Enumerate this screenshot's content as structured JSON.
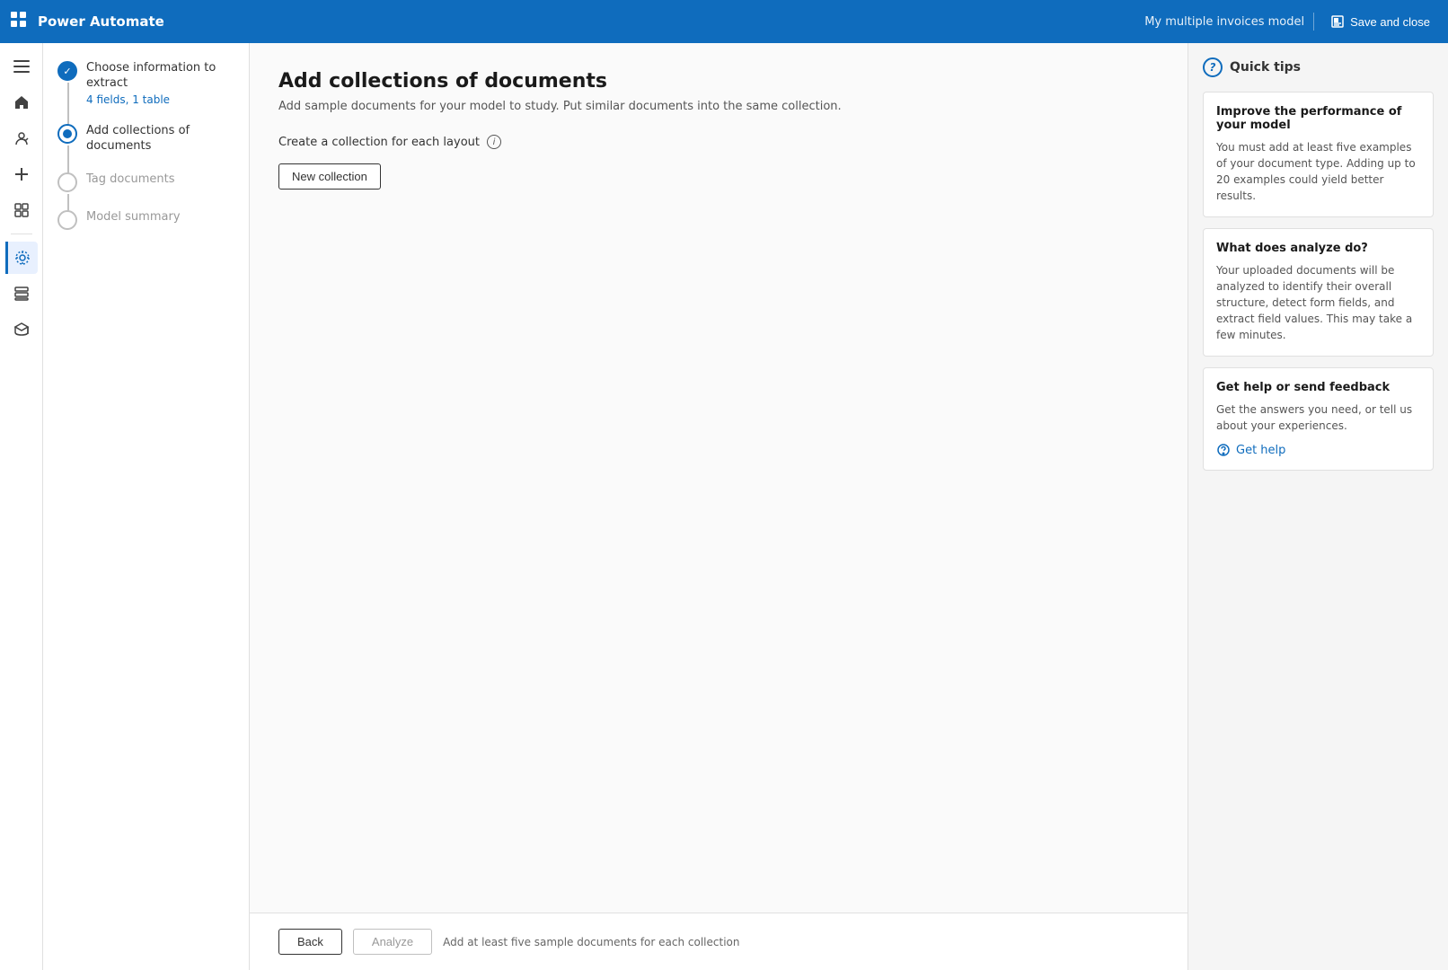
{
  "topbar": {
    "app_title": "Power Automate",
    "model_name": "My multiple invoices model",
    "save_close_label": "Save and close",
    "apps_icon": "⊞"
  },
  "wizard": {
    "steps": [
      {
        "id": "choose-info",
        "title": "Choose information to extract",
        "subtitle": "4 fields, 1 table",
        "state": "completed"
      },
      {
        "id": "add-collections",
        "title": "Add collections of documents",
        "subtitle": "",
        "state": "active"
      },
      {
        "id": "tag-documents",
        "title": "Tag documents",
        "subtitle": "",
        "state": "disabled"
      },
      {
        "id": "model-summary",
        "title": "Model summary",
        "subtitle": "",
        "state": "disabled"
      }
    ]
  },
  "content": {
    "page_title": "Add collections of documents",
    "page_subtitle": "Add sample documents for your model to study. Put similar documents into the same collection.",
    "collection_label": "Create a collection for each layout",
    "new_collection_button": "New collection"
  },
  "quick_tips": {
    "header": "Quick tips",
    "icon_label": "?",
    "tip1_title": "Improve the performance of your model",
    "tip1_text": "You must add at least five examples of your document type. Adding up to 20 examples could yield better results.",
    "tip2_title": "What does analyze do?",
    "tip2_text": "Your uploaded documents will be analyzed to identify their overall structure, detect form fields, and extract field values. This may take a few minutes.",
    "tip3_title": "Get help or send feedback",
    "tip3_text": "Get the answers you need, or tell us about your experiences.",
    "get_help_label": "Get help"
  },
  "bottom_bar": {
    "back_label": "Back",
    "analyze_label": "Analyze",
    "hint": "Add at least five sample documents for each collection"
  },
  "nav_icons": [
    {
      "name": "menu",
      "symbol": "☰",
      "active": false
    },
    {
      "name": "home",
      "symbol": "⌂",
      "active": false
    },
    {
      "name": "apps",
      "symbol": "⊞",
      "active": false
    },
    {
      "name": "create",
      "symbol": "+",
      "active": false
    },
    {
      "name": "monitor",
      "symbol": "◫",
      "active": false
    },
    {
      "name": "ai-models",
      "symbol": "◈",
      "active": true
    },
    {
      "name": "data",
      "symbol": "⊟",
      "active": false
    },
    {
      "name": "learn",
      "symbol": "⊕",
      "active": false
    }
  ]
}
